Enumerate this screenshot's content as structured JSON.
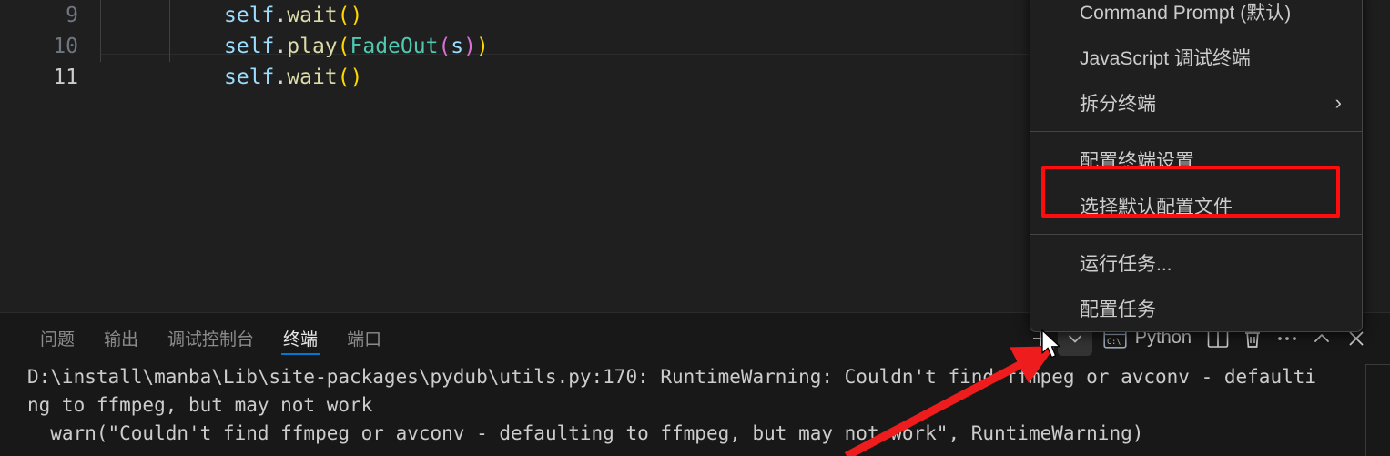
{
  "editor": {
    "lines": [
      {
        "number": "9",
        "active": false,
        "tokens": [
          {
            "t": "self",
            "c": "t-self"
          },
          {
            "t": ".",
            "c": "t-dot"
          },
          {
            "t": "wait",
            "c": "t-fn"
          },
          {
            "t": "(",
            "c": "t-p1"
          },
          {
            "t": ")",
            "c": "t-p1"
          }
        ]
      },
      {
        "number": "10",
        "active": false,
        "tokens": [
          {
            "t": "self",
            "c": "t-self"
          },
          {
            "t": ".",
            "c": "t-dot"
          },
          {
            "t": "play",
            "c": "t-fn"
          },
          {
            "t": "(",
            "c": "t-p1"
          },
          {
            "t": "FadeOut",
            "c": "t-cls"
          },
          {
            "t": "(",
            "c": "t-p2"
          },
          {
            "t": "s",
            "c": "t-var"
          },
          {
            "t": ")",
            "c": "t-p2"
          },
          {
            "t": ")",
            "c": "t-p1"
          }
        ]
      },
      {
        "number": "11",
        "active": true,
        "tokens": [
          {
            "t": "self",
            "c": "t-self"
          },
          {
            "t": ".",
            "c": "t-dot"
          },
          {
            "t": "wait",
            "c": "t-fn"
          },
          {
            "t": "(",
            "c": "t-p1"
          },
          {
            "t": ")",
            "c": "t-p1"
          }
        ]
      }
    ]
  },
  "panel": {
    "tabs": [
      {
        "label": "问题",
        "active": false
      },
      {
        "label": "输出",
        "active": false
      },
      {
        "label": "调试控制台",
        "active": false
      },
      {
        "label": "终端",
        "active": true
      },
      {
        "label": "端口",
        "active": false
      }
    ],
    "actions": {
      "new_terminal": "new-terminal-icon",
      "dropdown": "chevron-down-icon",
      "terminal_profile_label": "Python",
      "terminal_profile_icon": "terminal-cmd-icon",
      "split": "split-panel-icon",
      "kill": "trash-icon",
      "more": "ellipsis-icon",
      "maximize": "chevron-up-icon",
      "close": "close-icon"
    },
    "terminal_lines": [
      "D:\\install\\manba\\Lib\\site-packages\\pydub\\utils.py:170: RuntimeWarning: Couldn't find ffmpeg or avconv - defaulti",
      "ng to ffmpeg, but may not work",
      "  warn(\"Couldn't find ffmpeg or avconv - defaulting to ffmpeg, but may not work\", RuntimeWarning)"
    ]
  },
  "menu": {
    "items": [
      {
        "label": "Command Prompt (默认)",
        "submenu": false,
        "highlighted": false
      },
      {
        "label": "JavaScript 调试终端",
        "submenu": false,
        "highlighted": false
      },
      {
        "label": "拆分终端",
        "submenu": true,
        "highlighted": false,
        "chevron": "›"
      },
      {
        "separator": true
      },
      {
        "label": "配置终端设置",
        "submenu": false,
        "highlighted": false
      },
      {
        "label": "选择默认配置文件",
        "submenu": false,
        "highlighted": true
      },
      {
        "separator": true
      },
      {
        "label": "运行任务...",
        "submenu": false,
        "highlighted": false
      },
      {
        "label": "配置任务",
        "submenu": false,
        "highlighted": false
      }
    ]
  },
  "annotations": {
    "highlight_color": "#ff0d0d",
    "arrow_color": "#ee1c1c"
  }
}
